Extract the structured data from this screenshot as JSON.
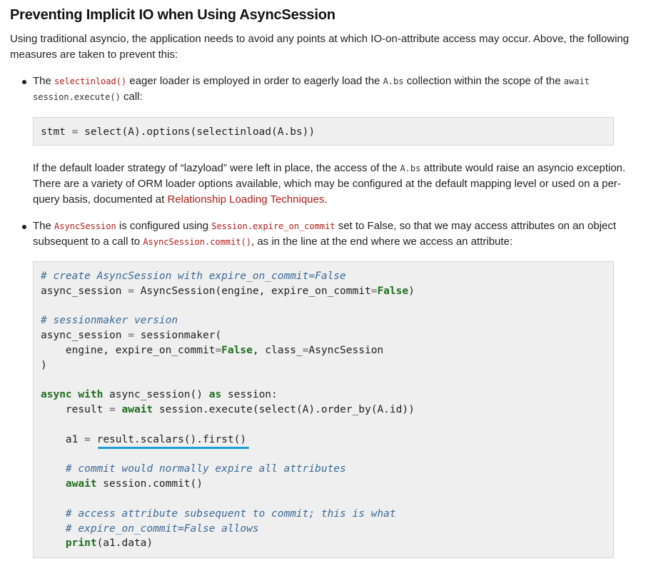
{
  "section": {
    "title": "Preventing Implicit IO when Using AsyncSession",
    "intro": "Using traditional asyncio, the application needs to avoid any points at which IO-on-attribute access may occur. Above, the following measures are taken to prevent this:"
  },
  "bullet1": {
    "t1": "The ",
    "c1": "selectinload()",
    "t2": " eager loader is employed in order to eagerly load the ",
    "c2": "A.bs",
    "t3": " collection within the scope of the ",
    "c3": "await session.execute()",
    "t4": " call:",
    "code": {
      "l1a": "stmt",
      "l1b": " = ",
      "l1c": "select(A).options(selectinload(A.bs))"
    },
    "p2": {
      "t1": "If the default loader strategy of “lazyload” were left in place, the access of the ",
      "c1": "A.bs",
      "t2": " attribute would raise an asyncio exception. There are a variety of ORM loader options available, which may be configured at the default mapping level or used on a per-query basis, documented at ",
      "link": "Relationship Loading Techniques",
      "t3": "."
    }
  },
  "bullet2": {
    "t1": "The ",
    "c1": "AsyncSession",
    "t2": " is configured using ",
    "c2": "Session.expire_on_commit",
    "t3": " set to False, so that we may access attributes on an object subsequent to a call to ",
    "c3": "AsyncSession.commit()",
    "t4": ", as in the line at the end where we access an attribute:"
  },
  "code2": {
    "comment1": "# create AsyncSession with expire_on_commit=False",
    "l2a": "async_session",
    "l2b": " = ",
    "l2c": "AsyncSession(engine, expire_on_commit",
    "l2d": "=",
    "l2e": "False",
    "l2f": ")",
    "comment2": "# sessionmaker version",
    "l5a": "async_session",
    "l5b": " = ",
    "l5c": "sessionmaker(",
    "l6a": "    engine, expire_on_commit",
    "l6b": "=",
    "l6c": "False",
    "l6d": ", class_",
    "l6e": "=",
    "l6f": "AsyncSession",
    "l7": ")",
    "l9a": "async",
    "l9b": " ",
    "l9c": "with",
    "l9d": " async_session() ",
    "l9e": "as",
    "l9f": " session:",
    "l10a": "    result",
    "l10b": " = ",
    "l10c": "await",
    "l10d": " session.execute(select(A).order_by(A.id))",
    "l12a": "    a1",
    "l12b": " = ",
    "l12c": "result.scalars().first()",
    "comment3": "    # commit would normally expire all attributes",
    "l15a": "    ",
    "l15b": "await",
    "l15c": " session.commit()",
    "comment4": "    # access attribute subsequent to commit; this is what",
    "comment5": "    # expire_on_commit=False allows",
    "l19a": "    ",
    "l19b": "print",
    "l19c": "(a1.data)"
  },
  "colors": {
    "inline_code": "#b01c1c",
    "link": "#b01c1c",
    "comment": "#3b6a96",
    "keyword": "#1f6f1f",
    "highlight_underline": "#1e9cd6"
  }
}
